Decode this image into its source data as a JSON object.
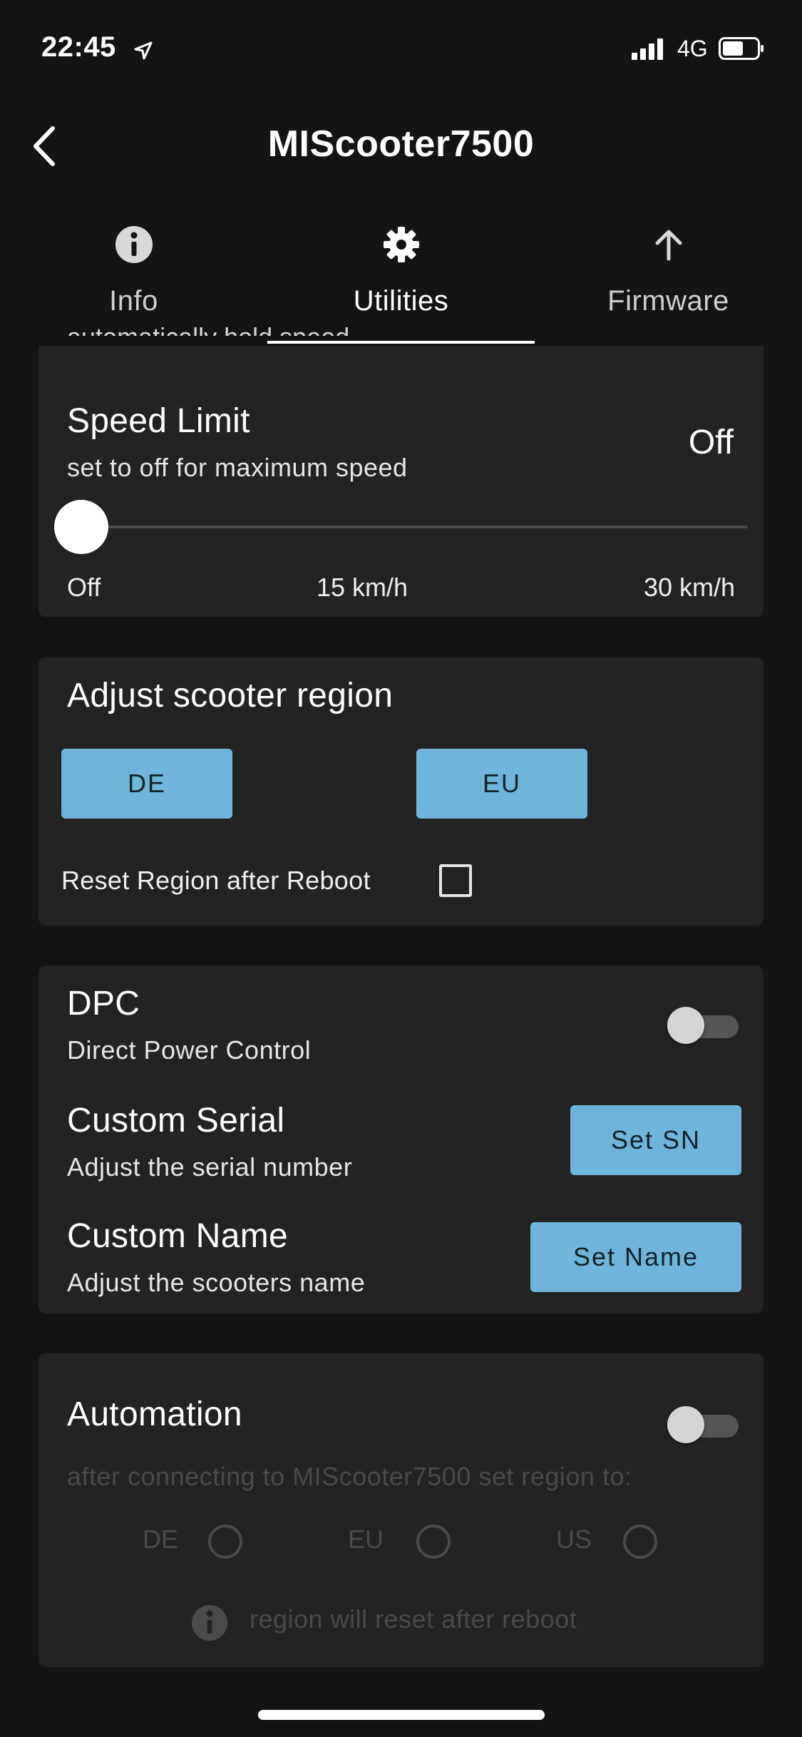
{
  "status_bar": {
    "time": "22:45",
    "network": "4G"
  },
  "header": {
    "title": "MIScooter7500"
  },
  "tabs": [
    {
      "label": "Info",
      "icon": "info-icon"
    },
    {
      "label": "Utilities",
      "icon": "gear-icon",
      "active": true
    },
    {
      "label": "Firmware",
      "icon": "arrow-up-icon"
    }
  ],
  "cruise_partial": {
    "cut_text": "automatically hold speed"
  },
  "speed_limit": {
    "title": "Speed Limit",
    "subtitle": "set to off for maximum speed",
    "value": "Off",
    "ticks": [
      "Off",
      "15 km/h",
      "30 km/h"
    ],
    "slider_position": 0
  },
  "region": {
    "title": "Adjust scooter region",
    "buttons": [
      "DE",
      "EU"
    ],
    "reset_label": "Reset Region after Reboot",
    "reset_checked": false
  },
  "dpc": {
    "title": "DPC",
    "subtitle": "Direct Power Control",
    "enabled": false,
    "serial_title": "Custom Serial",
    "serial_subtitle": "Adjust the serial number",
    "serial_button": "Set SN",
    "name_title": "Custom Name",
    "name_subtitle": "Adjust the scooters name",
    "name_button": "Set Name"
  },
  "automation": {
    "title": "Automation",
    "enabled": false,
    "subtitle": "after connecting to MIScooter7500 set region to:",
    "options": [
      "DE",
      "EU",
      "US"
    ],
    "note": "region will reset after reboot"
  },
  "colors": {
    "background": "#141414",
    "card": "#232323",
    "accent_button": "#6fb5d9",
    "disabled_text": "#4a4a4a"
  }
}
